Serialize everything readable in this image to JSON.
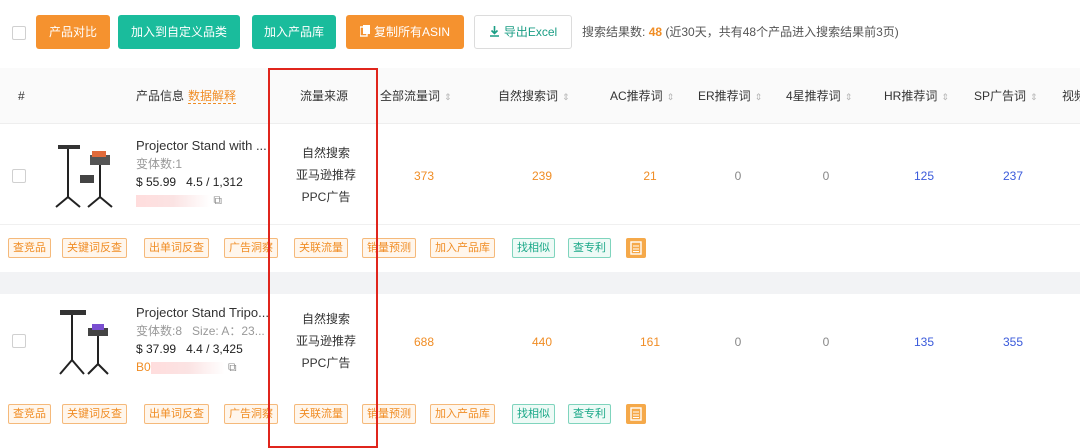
{
  "toolbar": {
    "compare": "产品对比",
    "add_category": "加入到自定义品类",
    "add_library": "加入产品库",
    "copy_asin": "复制所有ASIN",
    "export": "导出Excel",
    "search_label": "搜索结果数:",
    "search_count": "48",
    "search_note": "(近30天，共有48个产品进入搜索结果前3页)"
  },
  "header": {
    "index": "#",
    "product": "产品信息",
    "product_note": "数据解释",
    "source": "流量来源",
    "all": "全部流量词",
    "organic": "自然搜索词",
    "ac": "AC推荐词",
    "er": "ER推荐词",
    "star4": "4星推荐词",
    "hr": "HR推荐词",
    "sp": "SP广告词",
    "video": "视频"
  },
  "rows": [
    {
      "title": "Projector Stand with ...",
      "variants": "变体数:1",
      "price": "$ 55.99",
      "rating": "4.5 / 1,312",
      "asin": "",
      "sources": [
        "自然搜索",
        "亚马逊推荐",
        "PPC广告"
      ],
      "all": "373",
      "organic": "239",
      "ac": "21",
      "er": "0",
      "star4": "0",
      "hr": "125",
      "sp": "237"
    },
    {
      "title": "Projector Stand Tripo...",
      "variants": "变体数:8",
      "size": "Size: A：23...",
      "price": "$ 37.99",
      "rating": "4.4 / 3,425",
      "asin": "B0",
      "sources": [
        "自然搜索",
        "亚马逊推荐",
        "PPC广告"
      ],
      "all": "688",
      "organic": "440",
      "ac": "161",
      "er": "0",
      "star4": "0",
      "hr": "135",
      "sp": "355"
    }
  ],
  "actions": [
    "查竞品",
    "关键词反查",
    "出单词反查",
    "广告洞察",
    "关联流量",
    "销量预测",
    "加入产品库",
    "找相似",
    "查专利"
  ],
  "colors": {
    "orange": "#f5922f",
    "teal": "#1abc9c",
    "highlight": "#e0251c"
  }
}
